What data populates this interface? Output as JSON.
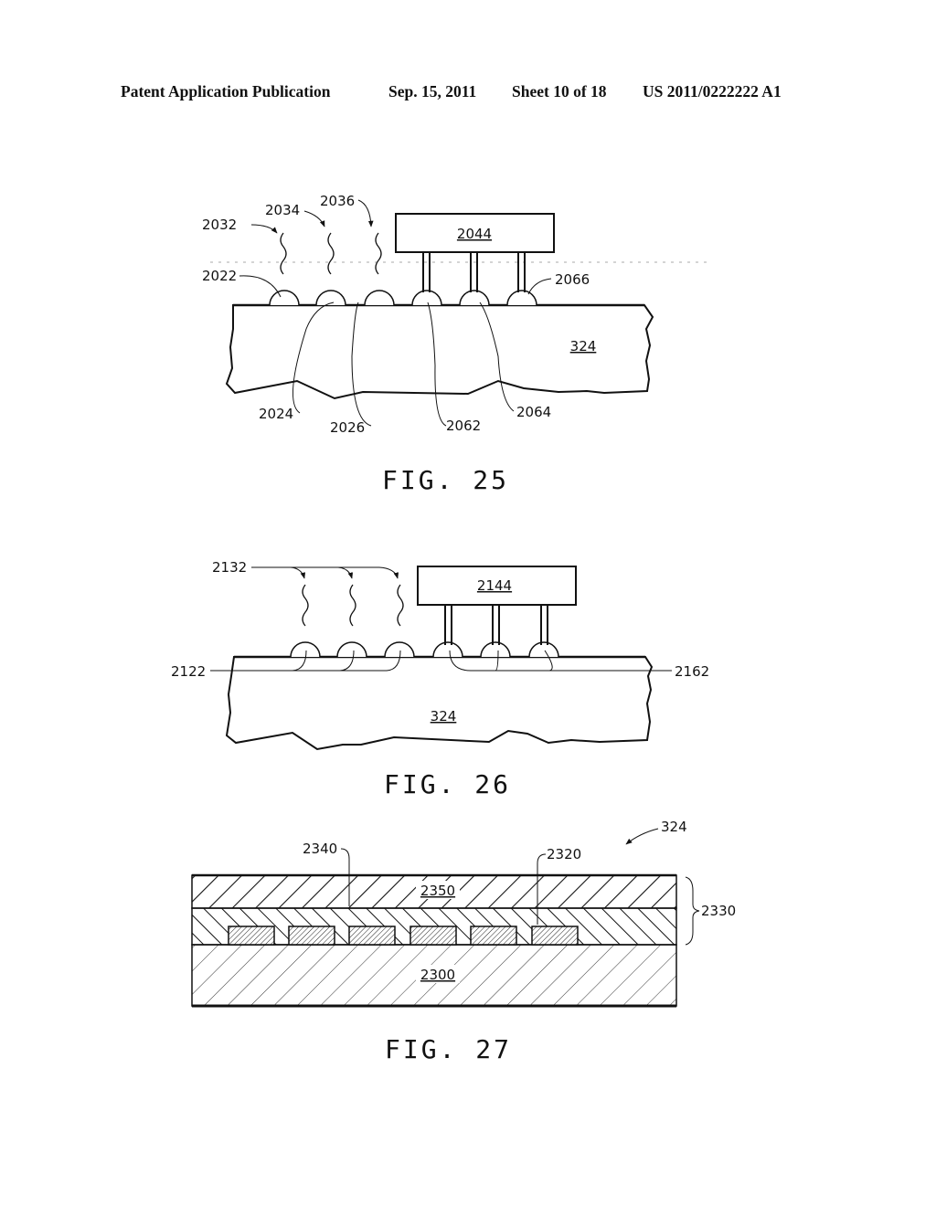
{
  "header": {
    "publication_type": "Patent Application Publication",
    "date": "Sep. 15, 2011",
    "sheet": "Sheet 10 of 18",
    "number": "US 2011/0222222 A1"
  },
  "fig25": {
    "caption": "FIG. 25",
    "substrate": "324",
    "component": "2044",
    "labels": {
      "radiation_1": "2032",
      "radiation_2": "2034",
      "radiation_3": "2036",
      "bump_1": "2022",
      "bump_2": "2024",
      "bump_3": "2026",
      "bump_4": "2062",
      "bump_5": "2064",
      "bump_6": "2066"
    }
  },
  "fig26": {
    "caption": "FIG. 26",
    "substrate": "324",
    "component": "2144",
    "labels": {
      "radiation": "2132",
      "left_pads": "2122",
      "right_pads": "2162"
    }
  },
  "fig27": {
    "caption": "FIG. 27",
    "assembly": "324",
    "labels": {
      "top_layer": "2350",
      "middle_layer": "2340",
      "traces": "2320",
      "stack": "2330",
      "base": "2300"
    }
  }
}
